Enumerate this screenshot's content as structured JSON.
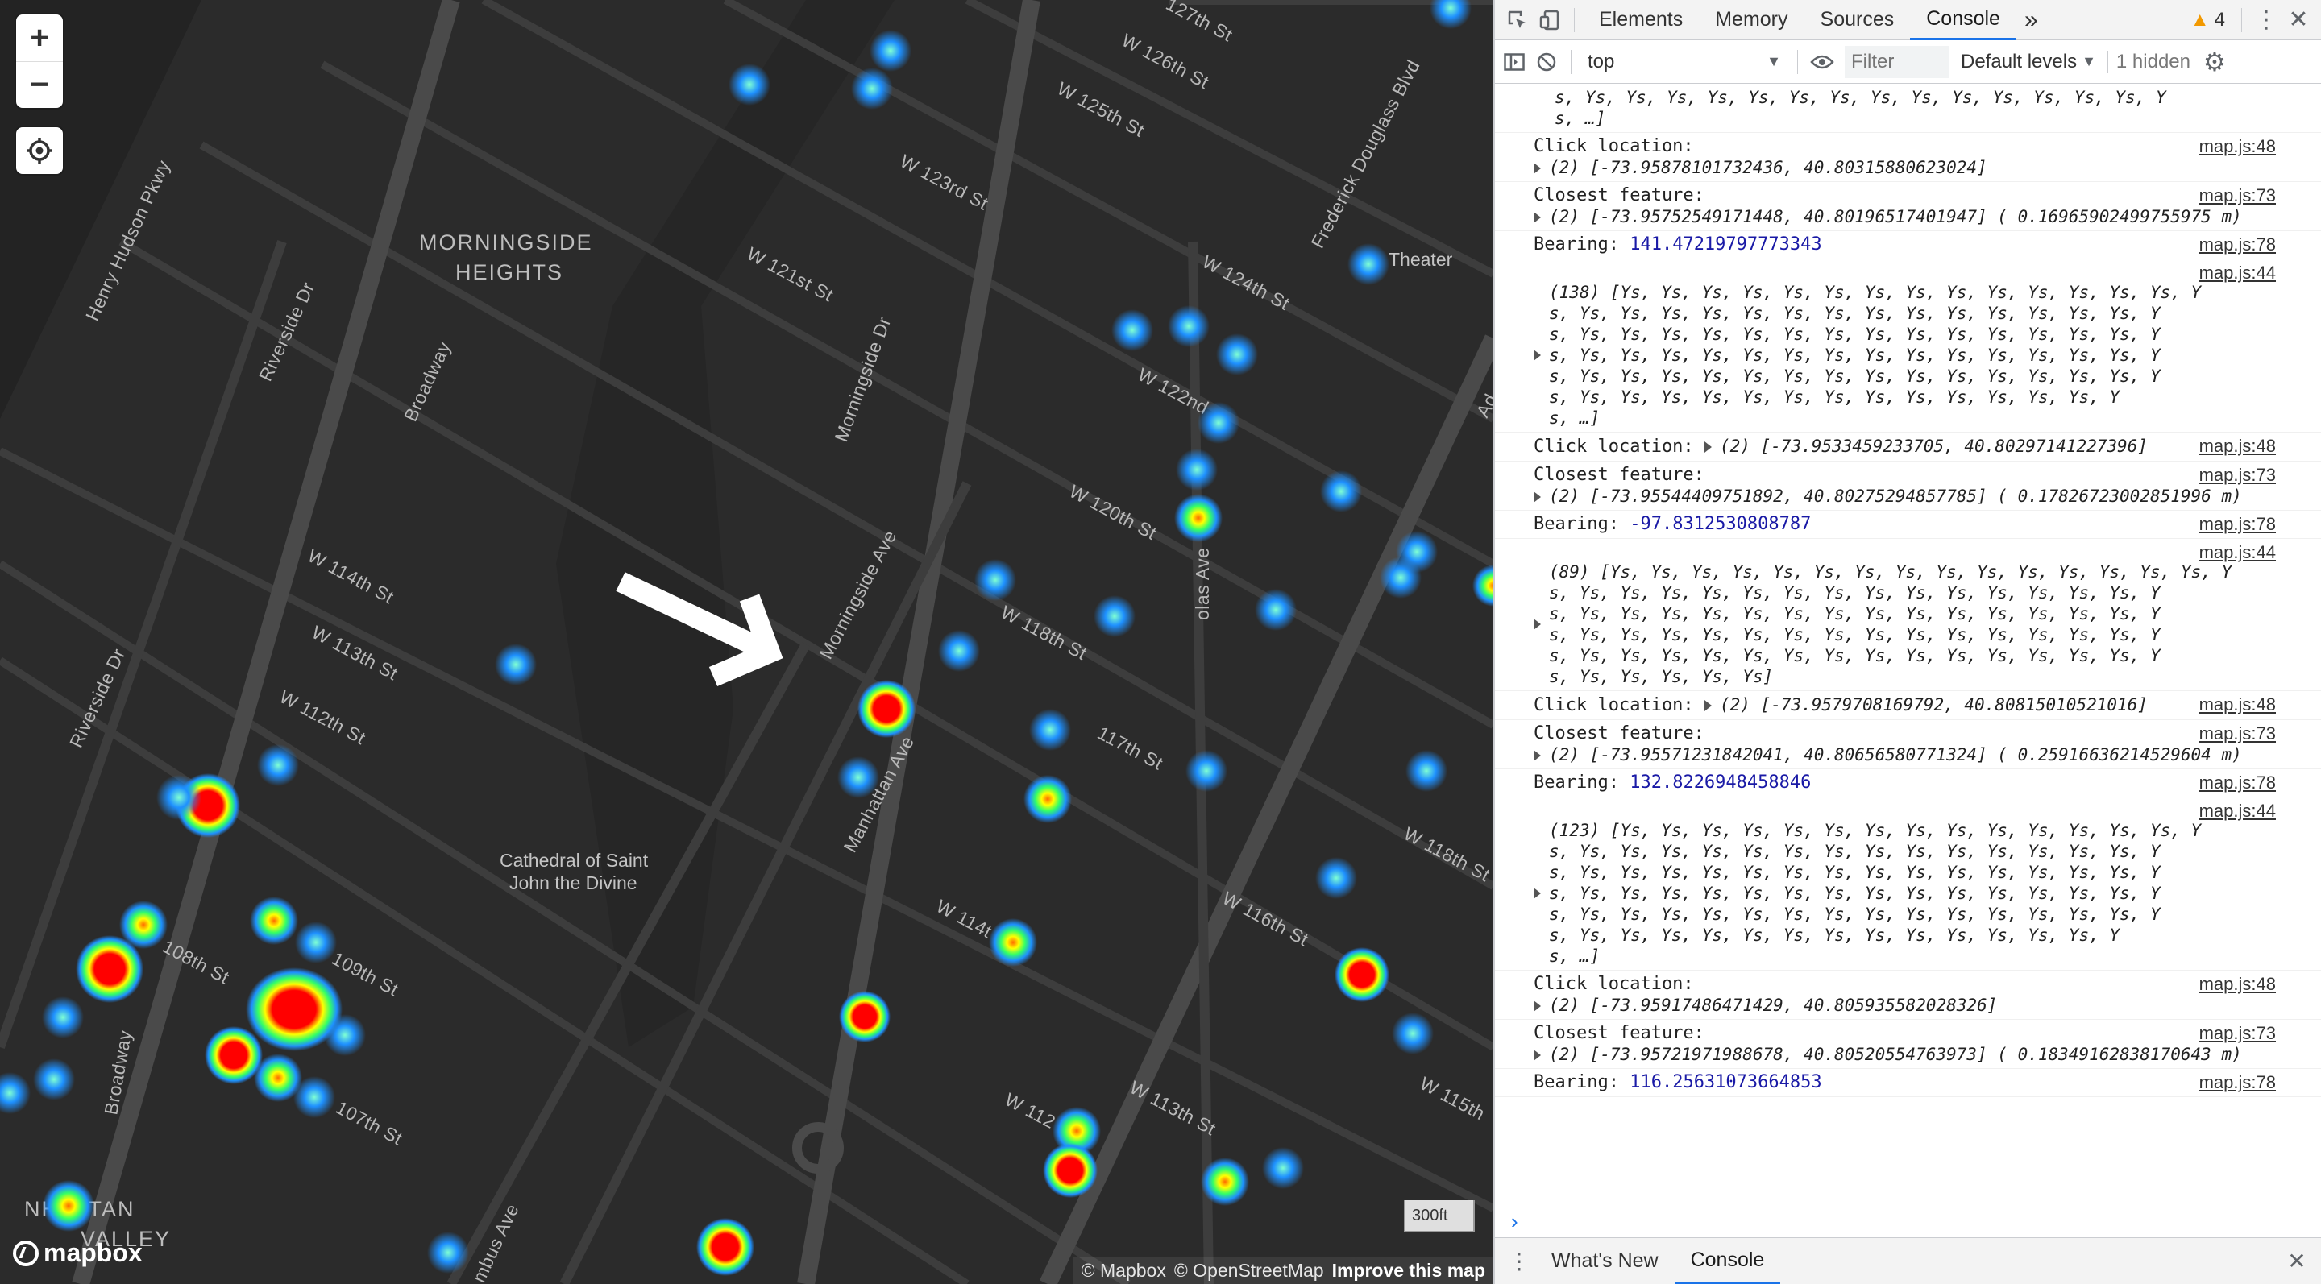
{
  "map": {
    "zoom_in": "+",
    "zoom_out": "−",
    "scale_label": "300ft",
    "attribution": {
      "mapbox": "© Mapbox",
      "osm": "© OpenStreetMap",
      "improve": "Improve this map"
    },
    "logo_text": "mapbox",
    "area_labels": [
      "MORNINGSIDE",
      "HEIGHTS",
      "NHATTAN",
      "VALLEY"
    ],
    "poi_labels": [
      "Cathedral of Saint",
      "John the Divine",
      "Theater"
    ],
    "street_labels": [
      "Henry Hudson Pkwy",
      "Riverside Dr",
      "Broadway",
      "W 114th St",
      "W 113th St",
      "W 112th St",
      "Riverside Dr",
      "108th St",
      "109th St",
      "107th St",
      "Broadway",
      "mbus Ave",
      "Morningside Dr",
      "Morningside Ave",
      "Manhattan Ave",
      "W 123rd St",
      "W 121st St",
      "W 120th St",
      "W 118th St",
      "117th St",
      "W 114t",
      "W 112",
      "W 113th St",
      "W 122nd",
      "W 124th St",
      "W 125th St",
      "W 126th St",
      "127th St",
      "Frederick Douglass Blvd",
      "olas Ave",
      "W 116th St",
      "W 118th St",
      "W 115th",
      "Ad"
    ],
    "colors": {
      "background": "#2b2b2b",
      "road": "#3d3d3d",
      "heat_low": "#1e90ff",
      "heat_mid": "#ffff00",
      "heat_high": "#ff0000"
    }
  },
  "devtools": {
    "tabs": [
      "Elements",
      "Memory",
      "Sources",
      "Console"
    ],
    "active_tab": "Console",
    "more_tabs": "»",
    "warnings_count": "4",
    "context": "top",
    "filter_placeholder": "Filter",
    "levels": "Default levels",
    "hidden": "1 hidden",
    "console": {
      "top_fragment": "s, Ys, Ys, Ys, Ys, Ys, Ys, Ys, Ys, Ys, Ys, Ys, Ys, Ys, Ys, Y\ns, …]",
      "entries": [
        {
          "label": "Click location:",
          "src": "map.js:48",
          "obj": "(2) [-73.95878101732436, 40.80315880623024]"
        },
        {
          "label": "Closest feature:",
          "src": "map.js:73",
          "obj": "(2) [-73.95752549171448, 40.80196517401947] ( 0.16965902499755975 m)"
        },
        {
          "label": "Bearing:",
          "src": "map.js:78",
          "value": "141.47219797773343"
        },
        {
          "src": "map.js:44",
          "arr": "(138) [Ys, Ys, Ys, Ys, Ys, Ys, Ys, Ys, Ys, Ys, Ys, Ys, Ys, Ys, Y\ns, Ys, Ys, Ys, Ys, Ys, Ys, Ys, Ys, Ys, Ys, Ys, Ys, Ys, Ys, Y\ns, Ys, Ys, Ys, Ys, Ys, Ys, Ys, Ys, Ys, Ys, Ys, Ys, Ys, Ys, Y\ns, Ys, Ys, Ys, Ys, Ys, Ys, Ys, Ys, Ys, Ys, Ys, Ys, Ys, Ys, Y\ns, Ys, Ys, Ys, Ys, Ys, Ys, Ys, Ys, Ys, Ys, Ys, Ys, Ys, Ys, Y\ns, Ys, Ys, Ys, Ys, Ys, Ys, Ys, Ys, Ys, Ys, Ys, Ys, Ys, Y\ns, …]"
        },
        {
          "label": "Click location:",
          "src": "map.js:48",
          "obj": "(2) [-73.9533459233705, 40.80297141227396]",
          "inline": true
        },
        {
          "label": "Closest feature:",
          "src": "map.js:73",
          "obj": "(2) [-73.95544409751892, 40.80275294857785] ( 0.17826723002851996 m)"
        },
        {
          "label": "Bearing:",
          "src": "map.js:78",
          "value": "-97.8312530808787"
        },
        {
          "src": "map.js:44",
          "arr": "(89) [Ys, Ys, Ys, Ys, Ys, Ys, Ys, Ys, Ys, Ys, Ys, Ys, Ys, Ys, Ys, Y\ns, Ys, Ys, Ys, Ys, Ys, Ys, Ys, Ys, Ys, Ys, Ys, Ys, Ys, Ys, Y\ns, Ys, Ys, Ys, Ys, Ys, Ys, Ys, Ys, Ys, Ys, Ys, Ys, Ys, Ys, Y\ns, Ys, Ys, Ys, Ys, Ys, Ys, Ys, Ys, Ys, Ys, Ys, Ys, Ys, Ys, Y\ns, Ys, Ys, Ys, Ys, Ys, Ys, Ys, Ys, Ys, Ys, Ys, Ys, Ys, Ys, Y\ns, Ys, Ys, Ys, Ys, Ys]"
        },
        {
          "label": "Click location:",
          "src": "map.js:48",
          "obj": "(2) [-73.9579708169792, 40.80815010521016]",
          "inline": true
        },
        {
          "label": "Closest feature:",
          "src": "map.js:73",
          "obj": "(2) [-73.95571231842041, 40.80656580771324] ( 0.25916636214529604 m)"
        },
        {
          "label": "Bearing:",
          "src": "map.js:78",
          "value": "132.8226948458846"
        },
        {
          "src": "map.js:44",
          "arr": "(123) [Ys, Ys, Ys, Ys, Ys, Ys, Ys, Ys, Ys, Ys, Ys, Ys, Ys, Ys, Y\ns, Ys, Ys, Ys, Ys, Ys, Ys, Ys, Ys, Ys, Ys, Ys, Ys, Ys, Ys, Y\ns, Ys, Ys, Ys, Ys, Ys, Ys, Ys, Ys, Ys, Ys, Ys, Ys, Ys, Ys, Y\ns, Ys, Ys, Ys, Ys, Ys, Ys, Ys, Ys, Ys, Ys, Ys, Ys, Ys, Ys, Y\ns, Ys, Ys, Ys, Ys, Ys, Ys, Ys, Ys, Ys, Ys, Ys, Ys, Ys, Ys, Y\ns, Ys, Ys, Ys, Ys, Ys, Ys, Ys, Ys, Ys, Ys, Ys, Ys, Ys, Y\ns, …]"
        },
        {
          "label": "Click location:",
          "src": "map.js:48",
          "obj": "(2) [-73.95917486471429, 40.805935582028326]"
        },
        {
          "label": "Closest feature:",
          "src": "map.js:73",
          "obj": "(2) [-73.95721971988678, 40.80520554763973] ( 0.18349162838170643 m)"
        },
        {
          "label": "Bearing:",
          "src": "map.js:78",
          "value": "116.25631073664853"
        }
      ]
    },
    "drawer_tabs": [
      "What's New",
      "Console"
    ]
  }
}
